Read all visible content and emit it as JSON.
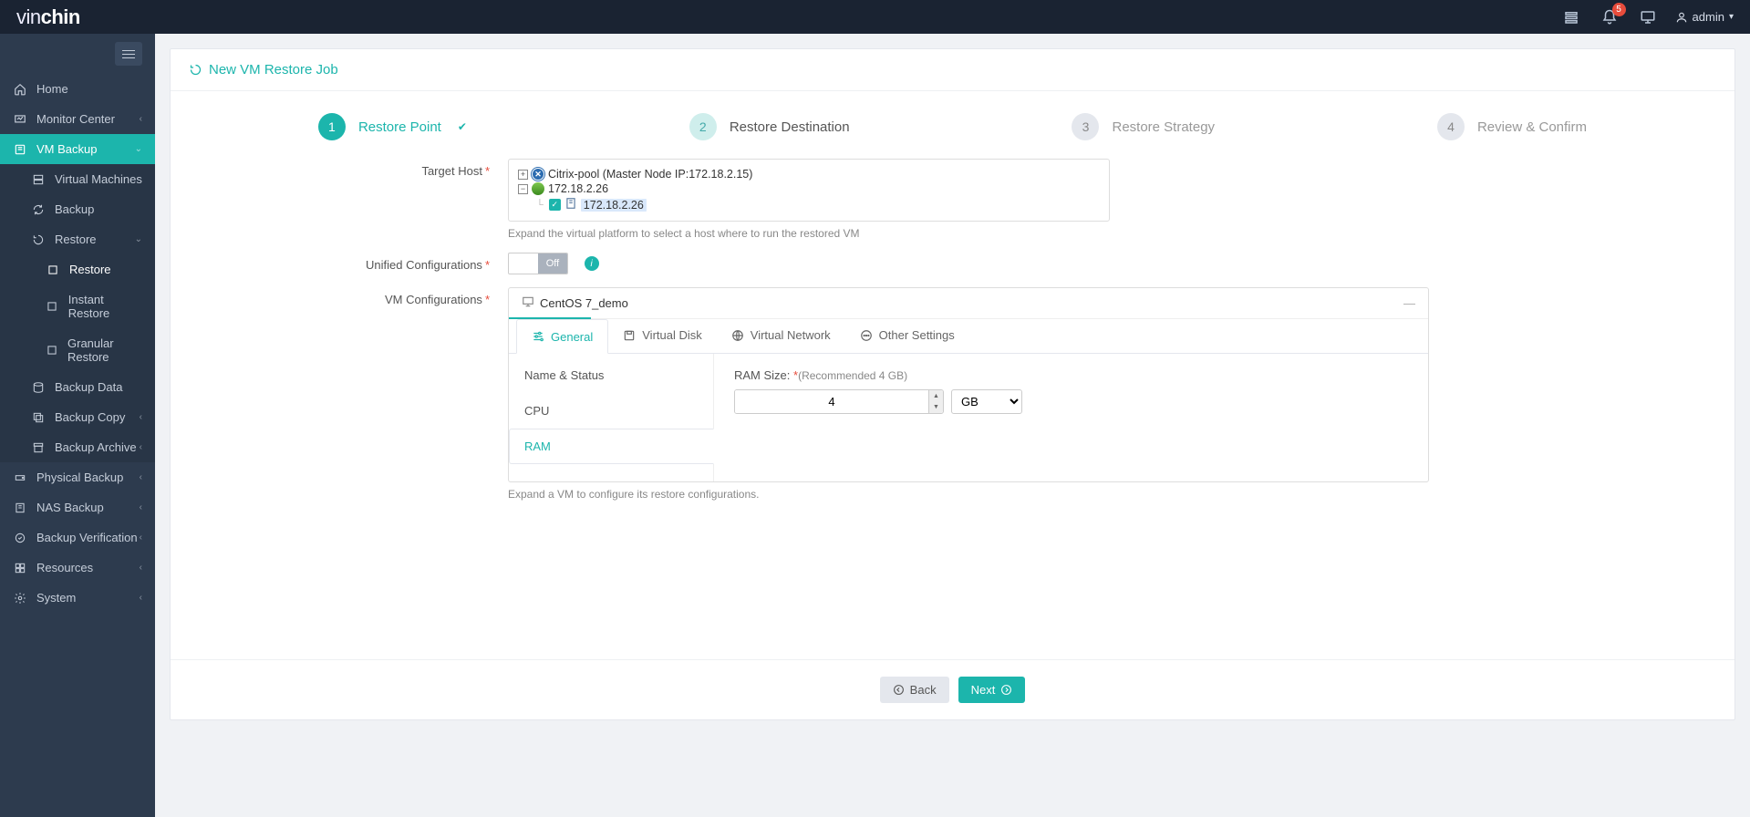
{
  "brand_thin": "vin",
  "brand_bold": "chin",
  "notif_count": "5",
  "user_name": "admin",
  "sidebar": {
    "home": "Home",
    "monitor": "Monitor Center",
    "vmbackup": "VM Backup",
    "virtual_machines": "Virtual Machines",
    "backup": "Backup",
    "restore": "Restore",
    "restore_sub": "Restore",
    "instant_restore": "Instant Restore",
    "granular_restore": "Granular Restore",
    "backup_data": "Backup Data",
    "backup_copy": "Backup Copy",
    "backup_archive": "Backup Archive",
    "physical_backup": "Physical Backup",
    "nas_backup": "NAS Backup",
    "backup_verification": "Backup Verification",
    "resources": "Resources",
    "system": "System"
  },
  "page_title": "New VM Restore Job",
  "steps": {
    "s1": "Restore Point",
    "s2": "Restore Destination",
    "s3": "Restore Strategy",
    "s4": "Review & Confirm"
  },
  "form": {
    "target_host": "Target Host",
    "tree_pool": "Citrix-pool (Master Node IP:172.18.2.15)",
    "tree_host1": "172.18.2.26",
    "tree_host2": "172.18.2.26",
    "target_hint": "Expand the virtual platform to select a host where to run the restored VM",
    "unified": "Unified Configurations",
    "off": "Off",
    "vm_config": "VM Configurations",
    "vm_name": "CentOS 7_demo",
    "tab_general": "General",
    "tab_vdisk": "Virtual Disk",
    "tab_vnet": "Virtual Network",
    "tab_other": "Other Settings",
    "side_name": "Name & Status",
    "side_cpu": "CPU",
    "side_ram": "RAM",
    "ram_label": "RAM Size:",
    "ram_rec": "(Recommended 4 GB)",
    "ram_value": "4",
    "ram_unit": "GB",
    "vm_hint": "Expand a VM to configure its restore configurations."
  },
  "btn_back": "Back",
  "btn_next": "Next"
}
